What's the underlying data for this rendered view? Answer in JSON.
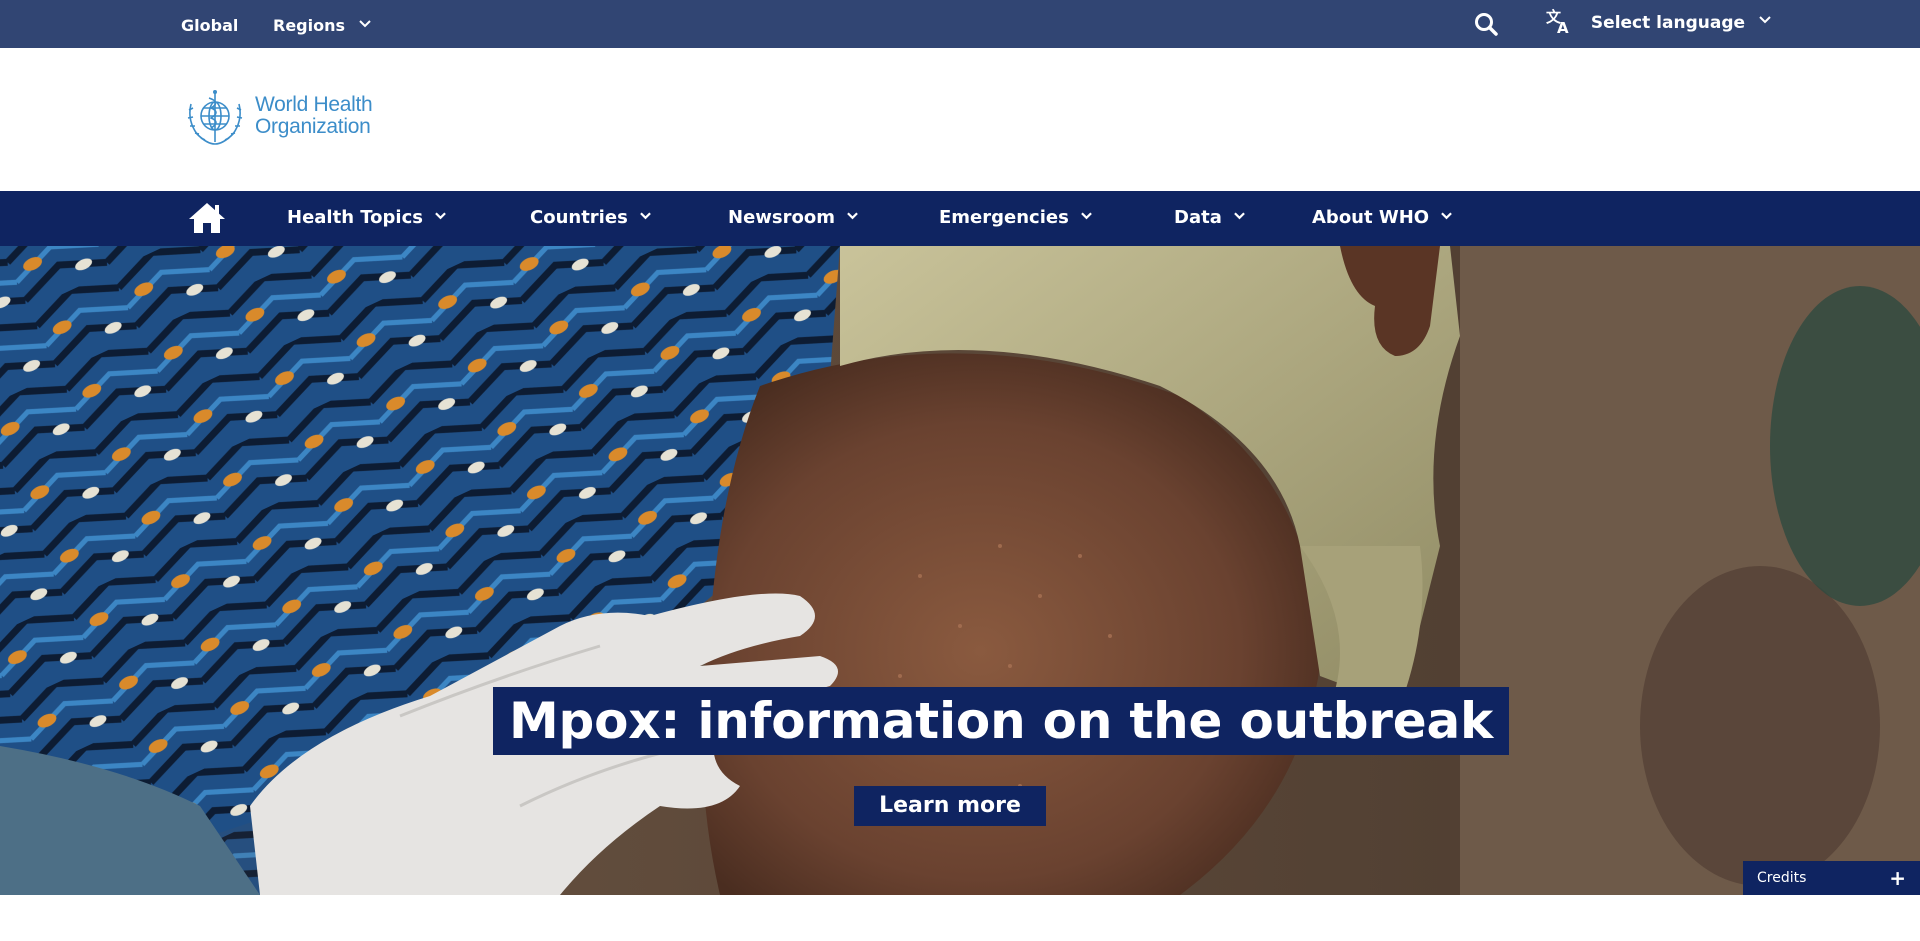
{
  "topbar": {
    "global_label": "Global",
    "regions_label": "Regions",
    "search_icon": "search-icon",
    "language_label": "Select language",
    "language_icon": "translate-icon"
  },
  "logo": {
    "line1": "World Health",
    "line2": "Organization"
  },
  "nav": {
    "home_icon": "home-icon",
    "items": [
      {
        "label": "Health Topics"
      },
      {
        "label": "Countries"
      },
      {
        "label": "Newsroom"
      },
      {
        "label": "Emergencies"
      },
      {
        "label": "Data"
      },
      {
        "label": "About WHO"
      }
    ]
  },
  "hero": {
    "headline": "Mpox: information on the outbreak",
    "cta_label": "Learn more",
    "credits_label": "Credits",
    "credits_toggle": "+"
  },
  "colors": {
    "topbar_bg": "#314573",
    "nav_bg": "#0f2461",
    "logo_blue": "#3c8dc9"
  }
}
